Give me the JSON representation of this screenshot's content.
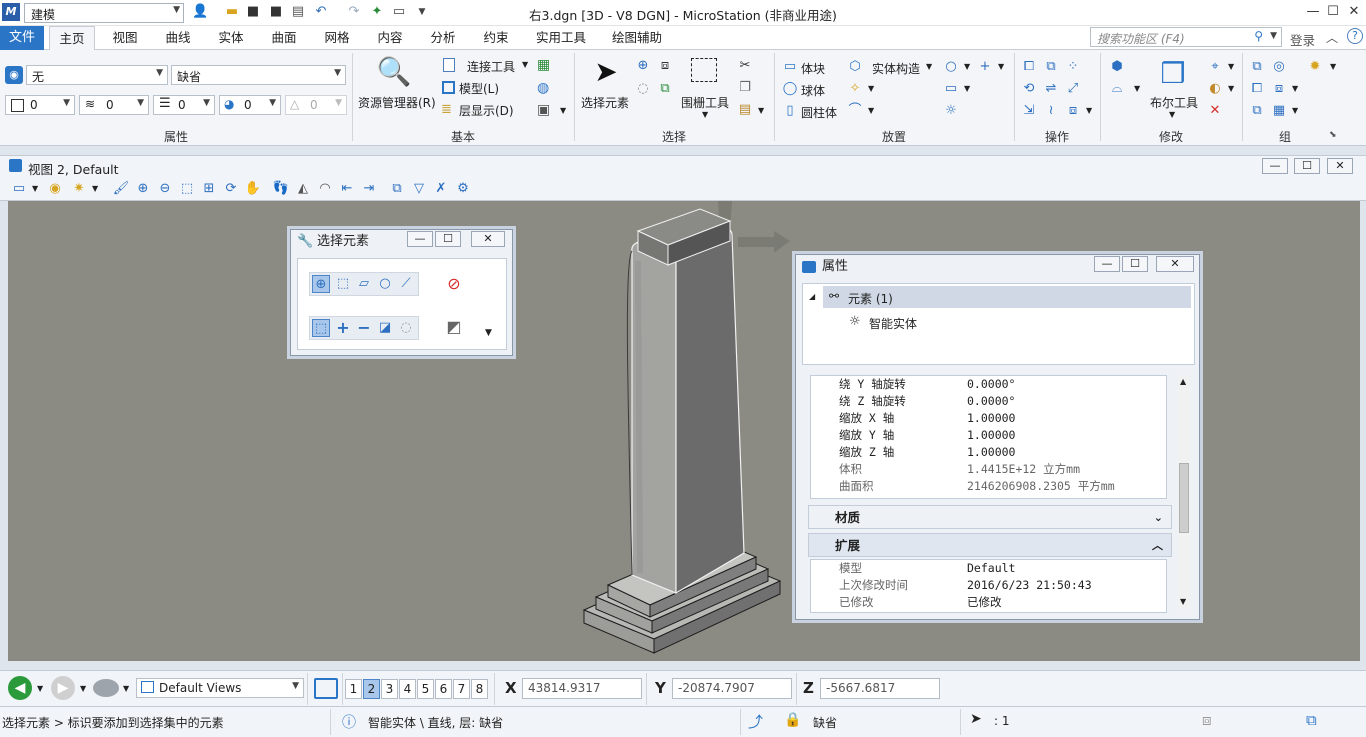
{
  "app": {
    "workspace": "建模",
    "title": "右3.dgn [3D - V8 DGN] - MicroStation (非商业用途)",
    "colors": {
      "accent": "#2b75c7",
      "viewport_bg": "#8b8b83",
      "delete_red": "#d62c2c"
    }
  },
  "tabs": {
    "file": "文件",
    "items": [
      "主页",
      "视图",
      "曲线",
      "实体",
      "曲面",
      "网格",
      "内容",
      "分析",
      "约束",
      "实用工具",
      "绘图辅助"
    ],
    "active": "主页"
  },
  "search": {
    "placeholder": "搜索功能区 (F4)",
    "login": "登录"
  },
  "ribbon": {
    "attributes": {
      "level": "无",
      "style": "缺省",
      "color": "0",
      "linestyle": "0",
      "weight": "0",
      "transparency": "0",
      "priority": "0",
      "title": "属性"
    },
    "basic": {
      "explorer": "资源管理器(R)",
      "attach_tools": "连接工具",
      "models": "模型(L)",
      "level_display": "层显示(D)",
      "title": "基本"
    },
    "selection": {
      "select_element": "选择元素",
      "fence_tools": "围栅工具",
      "title": "选择"
    },
    "placement": {
      "block": "体块",
      "sphere": "球体",
      "cylinder": "圆柱体",
      "solid_construct": "实体构造",
      "title": "放置"
    },
    "operations": {
      "title": "操作"
    },
    "modify": {
      "boolean": "布尔工具",
      "title": "修改"
    },
    "group": {
      "title": "组"
    }
  },
  "view": {
    "title": "视图 2, Default"
  },
  "select_dialog": {
    "title": "选择元素"
  },
  "properties": {
    "title": "属性",
    "tree": {
      "root": "元素 (1)",
      "child": "智能实体"
    },
    "rows": [
      {
        "k": "绕 Y 轴旋转",
        "v": "0.0000°"
      },
      {
        "k": "绕 Z 轴旋转",
        "v": "0.0000°"
      },
      {
        "k": "缩放 X 轴",
        "v": "1.00000"
      },
      {
        "k": "缩放 Y 轴",
        "v": "1.00000"
      },
      {
        "k": "缩放 Z 轴",
        "v": "1.00000"
      },
      {
        "k": "体积",
        "v": "1.4415E+12 立方mm"
      },
      {
        "k": "曲面积",
        "v": "2146206908.2305 平方mm"
      }
    ],
    "material": "材质",
    "extended": "扩展",
    "ext_rows": [
      {
        "k": "模型",
        "v": "Default"
      },
      {
        "k": "上次修改时间",
        "v": "2016/6/23 21:50:43"
      },
      {
        "k": "已修改",
        "v": "已修改"
      }
    ]
  },
  "statusbar": {
    "views_combo": "Default Views",
    "view_numbers": [
      "1",
      "2",
      "3",
      "4",
      "5",
      "6",
      "7",
      "8"
    ],
    "active_view": "2",
    "x_label": "X",
    "x": "43814.9317",
    "y_label": "Y",
    "y": "-20874.7907",
    "z_label": "Z",
    "z": "-5667.6817",
    "prompt": "选择元素 > 标识要添加到选择集中的元素",
    "info": "智能实体 \\ 直线, 层: 缺省",
    "level": "缺省",
    "selection_count": ": 1"
  }
}
